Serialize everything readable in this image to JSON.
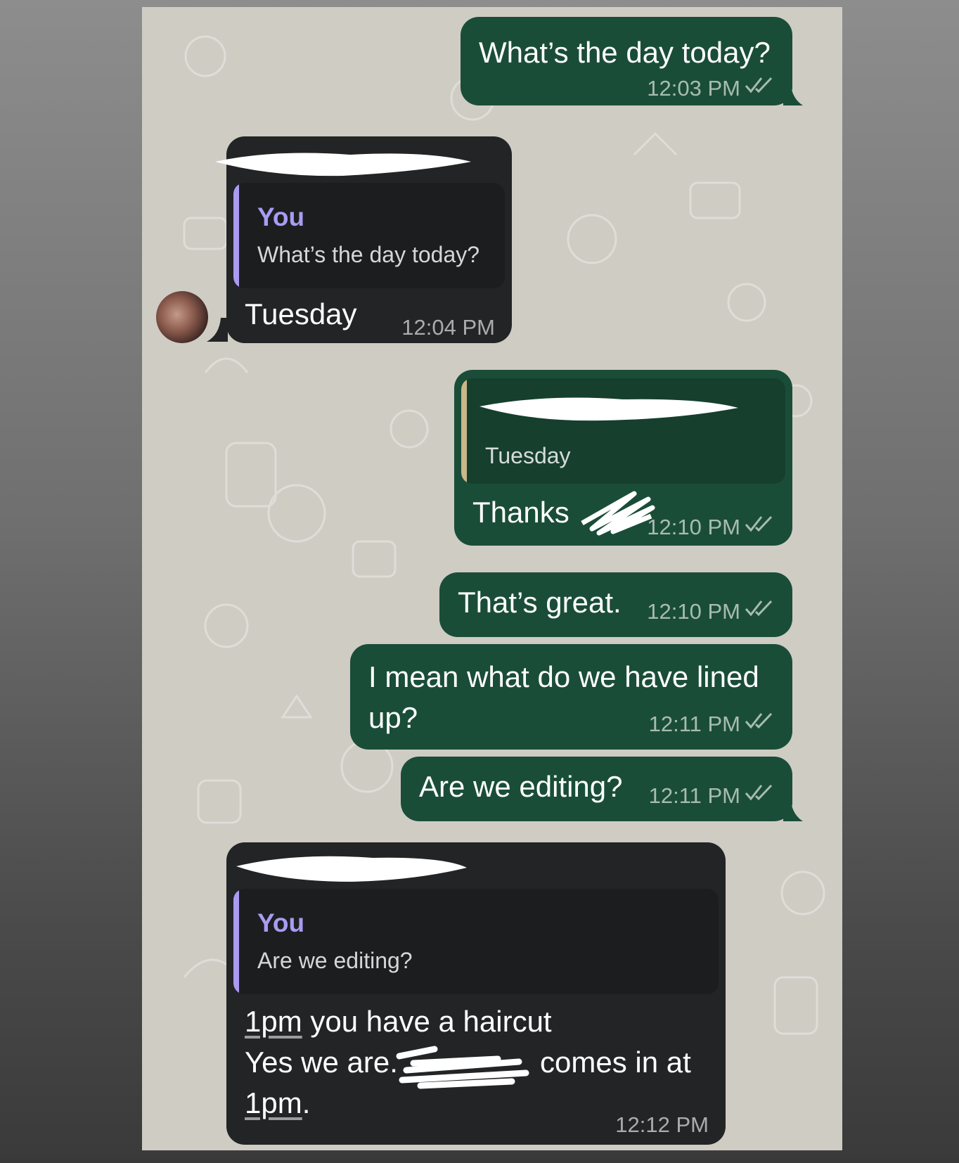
{
  "colors": {
    "outgoing": "#1a4d38",
    "incoming": "#222426",
    "reply_author": "#a99bf2",
    "wallpaper": "#cfccc4"
  },
  "messages": [
    {
      "text": "What’s the day today?",
      "time": "12:03 PM",
      "status": "double-check-icon"
    },
    {
      "reply_to": {
        "author": "You",
        "text": "What’s the day today?"
      },
      "text": "Tuesday",
      "time": "12:04 PM"
    },
    {
      "reply_to": {
        "text": "Tuesday"
      },
      "text": "Thanks",
      "time": "12:10 PM",
      "status": "double-check-icon"
    },
    {
      "text": "That’s great.",
      "time": "12:10 PM",
      "status": "double-check-icon"
    },
    {
      "text_lines": [
        "I mean what do we have lined",
        "up?"
      ],
      "time": "12:11 PM",
      "status": "double-check-icon"
    },
    {
      "text": "Are we editing?",
      "time": "12:11 PM",
      "status": "double-check-icon"
    },
    {
      "reply_to": {
        "author": "You",
        "text": "Are we editing?"
      },
      "text_parts": [
        "1pm",
        " you have a haircut",
        "Yes we are.",
        "comes in at",
        "1pm",
        "."
      ],
      "time": "12:12 PM"
    }
  ]
}
